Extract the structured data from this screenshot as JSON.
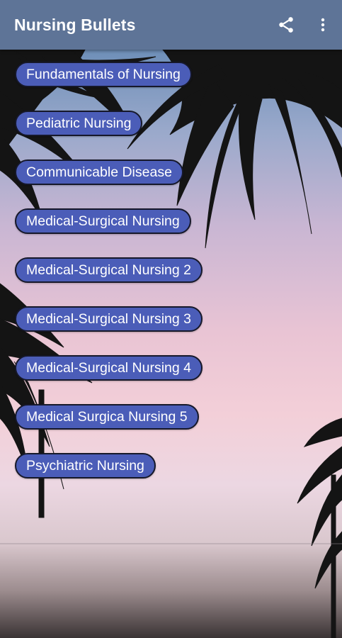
{
  "app": {
    "title": "Nursing Bullets"
  },
  "toolbar": {
    "share_icon": "share-icon",
    "more_icon": "more-vert-icon"
  },
  "colors": {
    "toolbar": "#5e7497",
    "button_fill": "#4b5db8",
    "button_border": "#16182a",
    "button_text": "#ffffff"
  },
  "menu": {
    "items": [
      {
        "label": "Fundamentals of Nursing"
      },
      {
        "label": "Pediatric Nursing"
      },
      {
        "label": "Communicable Disease"
      },
      {
        "label": "Medical-Surgical Nursing"
      },
      {
        "label": "Medical-Surgical Nursing 2"
      },
      {
        "label": "Medical-Surgical Nursing 3"
      },
      {
        "label": "Medical-Surgical Nursing 4"
      },
      {
        "label": "Medical Surgica Nursing 5"
      },
      {
        "label": "Psychiatric Nursing"
      }
    ]
  }
}
